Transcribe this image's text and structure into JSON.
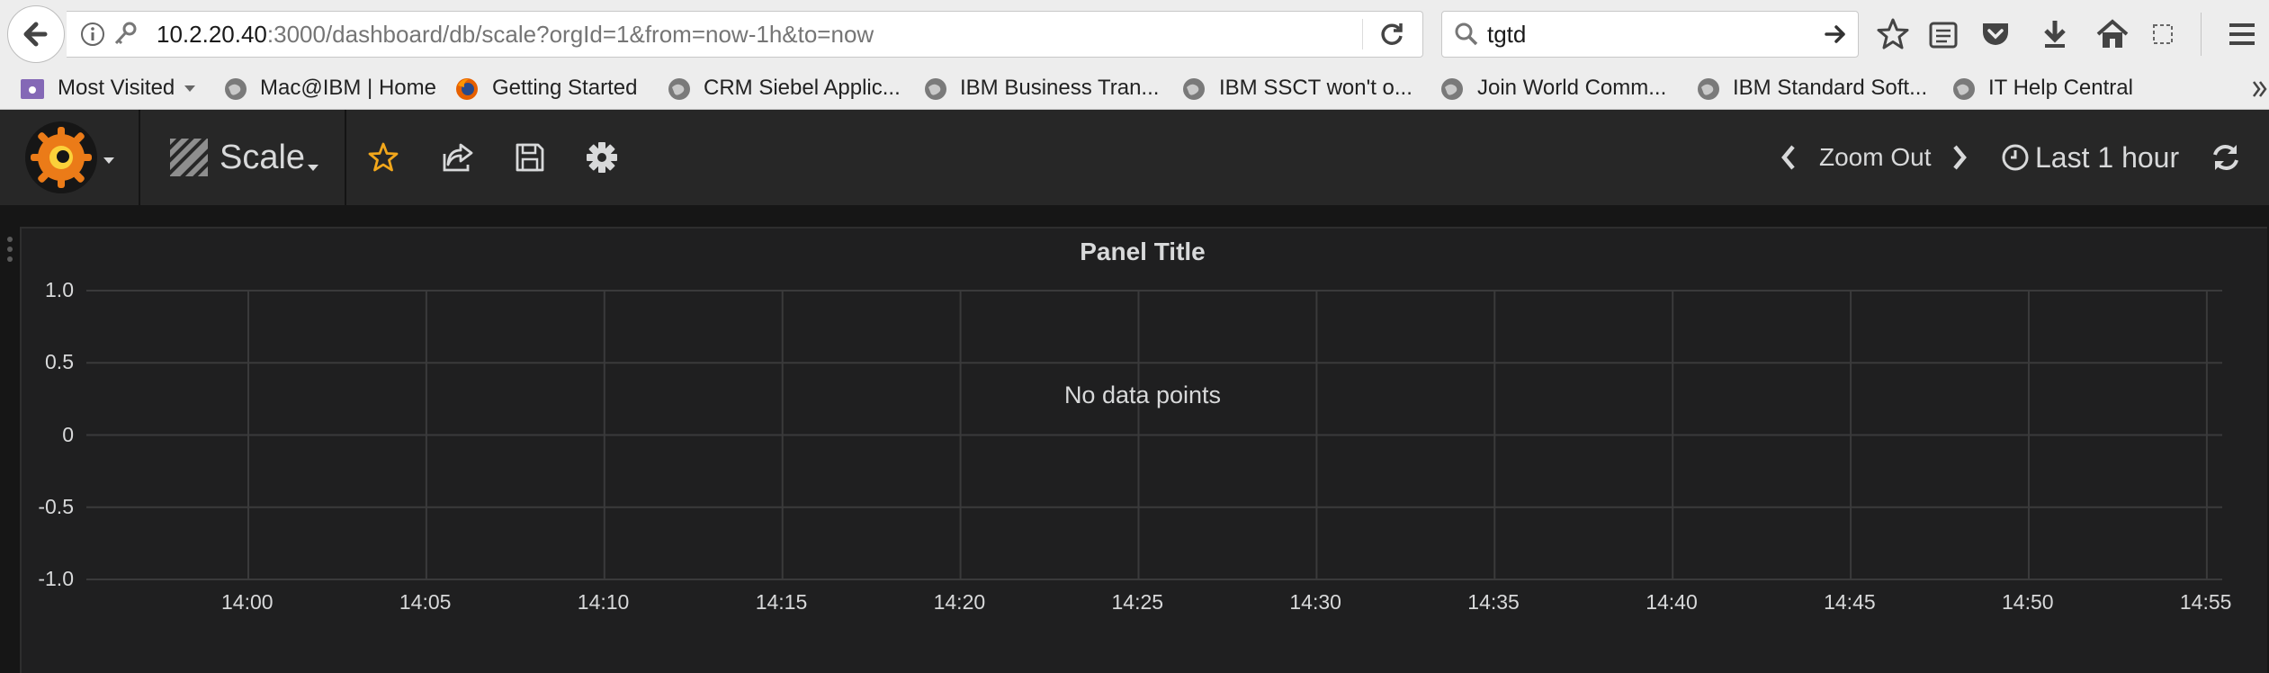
{
  "browser": {
    "url_host": "10.2.20.40",
    "url_path": ":3000/dashboard/db/scale?orgId=1&from=now-1h&to=now",
    "search_value": "tgtd",
    "bookmarks": [
      {
        "label": "Most Visited",
        "icon": "folder-icon"
      },
      {
        "label": "Mac@IBM | Home",
        "icon": "globe-icon"
      },
      {
        "label": "Getting Started",
        "icon": "firefox-icon"
      },
      {
        "label": "CRM Siebel Applic...",
        "icon": "globe-icon"
      },
      {
        "label": "IBM Business Tran...",
        "icon": "globe-icon"
      },
      {
        "label": "IBM SSCT won't o...",
        "icon": "globe-icon"
      },
      {
        "label": "Join World Comm...",
        "icon": "globe-icon"
      },
      {
        "label": "IBM Standard Soft...",
        "icon": "globe-icon"
      },
      {
        "label": "IT Help Central",
        "icon": "globe-icon"
      }
    ]
  },
  "grafana": {
    "dashboard_title": "Scale",
    "zoom_out_label": "Zoom Out",
    "time_range": "Last 1 hour",
    "accent": "#eb7b18",
    "star_color": "#f2a71b"
  },
  "panel": {
    "title": "Panel Title",
    "no_data": "No data points"
  },
  "chart_data": {
    "type": "line",
    "title": "Panel Title",
    "annotation": "No data points",
    "x_ticks": [
      "14:00",
      "14:05",
      "14:10",
      "14:15",
      "14:20",
      "14:25",
      "14:30",
      "14:35",
      "14:40",
      "14:45",
      "14:50",
      "14:55"
    ],
    "y_ticks": [
      "1.0",
      "0.5",
      "0",
      "-0.5",
      "-1.0"
    ],
    "ylim": [
      -1.0,
      1.0
    ],
    "grid": true,
    "series": []
  }
}
